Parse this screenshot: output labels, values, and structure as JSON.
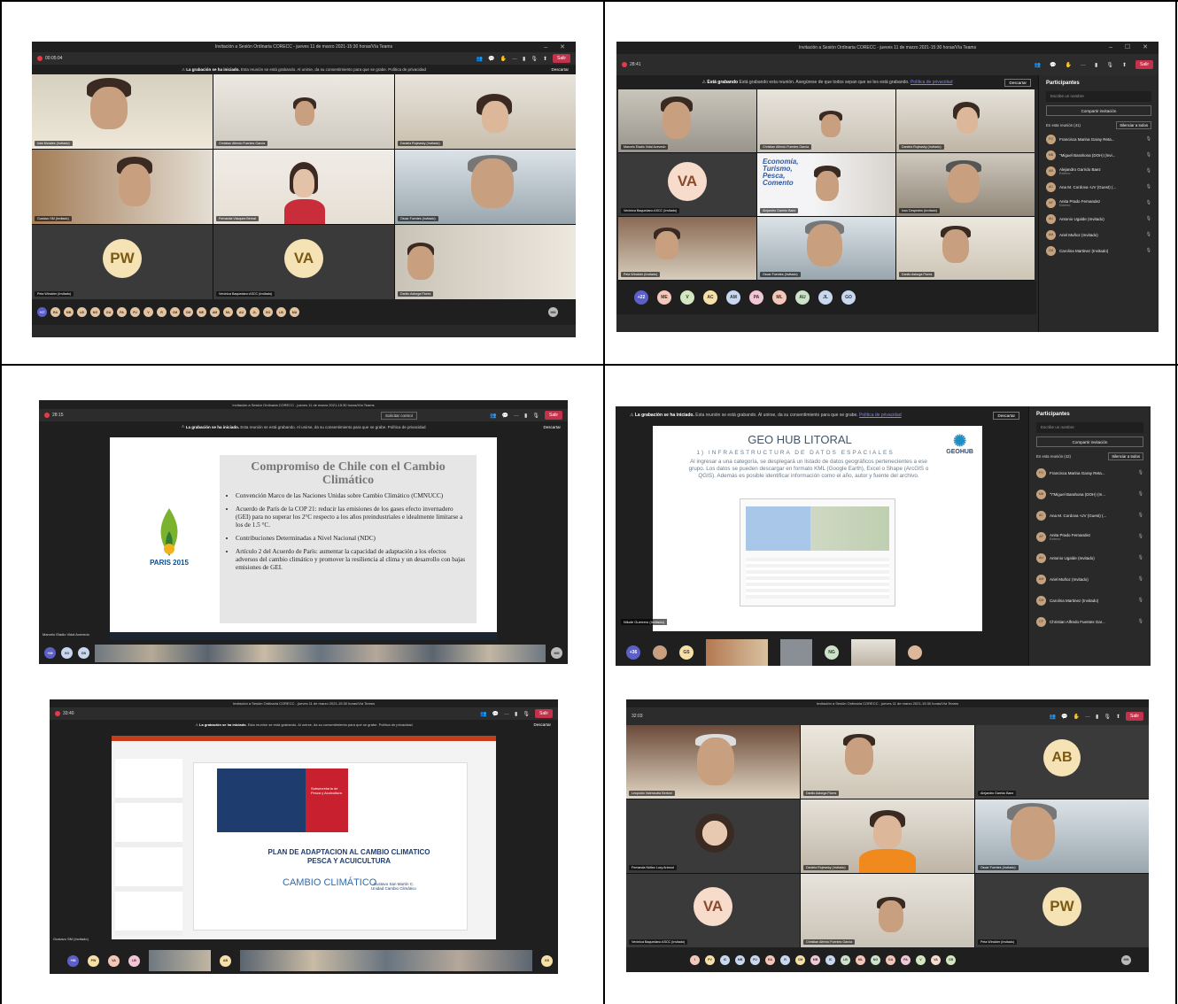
{
  "shot1": {
    "window_title": "Invitación a Sesión Ordinaria CORECC - jueves 11 de marzo 2021-15:30 horas/Vía Teams",
    "timer": "00:05:04",
    "leave_label": "Salir",
    "banner_bold": "La grabación se ha iniciado.",
    "banner_text": "Esta reunión se está grabando. Al unirse, da su consentimiento para que se grabe. Política de privacidad",
    "dismiss_label": "Descartar",
    "tiles": [
      {
        "name": "Iván Morales (Invitado)"
      },
      {
        "name": "Christian Alfredo Fuentes García"
      },
      {
        "name": "Daniela Rojewsky (Invitado)"
      },
      {
        "name": "Gustavo SM (Invitado)"
      },
      {
        "name": "Fernanda Vásquez Bernal"
      },
      {
        "name": "Oscar Fuentes (Invitado)"
      },
      {
        "name": "Peta Winckler (Invitado)",
        "avatar": "PW"
      },
      {
        "name": "Verónica Baquedano ASCC (Invitado)",
        "avatar": "VA"
      },
      {
        "name": "Danilo Astorga Flores"
      }
    ],
    "strip": [
      "+17",
      "RA",
      "MB",
      "LB",
      "NG",
      "OA",
      "PA",
      "FU",
      "V",
      "R",
      "CM",
      "CM",
      "ME",
      "AM",
      "ML",
      "AU",
      "JL",
      "GO",
      "LB",
      "MA"
    ],
    "self": "MM"
  },
  "shot2": {
    "window_title": "Invitación a Sesión Ordinaria CORECC - jueves 11 de marzo 2021-15:30 horas/Vía Teams",
    "timer": "28:41",
    "leave_label": "Salir",
    "banner_bold": "Está grabando",
    "banner_text": "Está grabando esta reunión. Asegúrese de que todos sepan que se les está grabando.",
    "policy": "Política de privacidad",
    "dismiss_label": "Descartar",
    "tiles": [
      {
        "name": "Marcelo Eladio Vidal Acevedo"
      },
      {
        "name": "Christian Alfredo Fuentes García"
      },
      {
        "name": "Daniela Rojewsky (Invitado)"
      },
      {
        "name": "Verónica Baquedano ASCC (Invitado)",
        "avatar": "VA"
      },
      {
        "name": "Alejandro Garrido Baez"
      },
      {
        "name": "Ivan Cespedes (Invitado)"
      },
      {
        "name": "Peta Winckler (Invitado)"
      },
      {
        "name": "Oscar Fuentes (Invitado)"
      },
      {
        "name": "Danilo Astorga Flores"
      }
    ],
    "strip": [
      "+22",
      "ME",
      "V",
      "AC",
      "AM",
      "PA",
      "ML",
      "AU",
      "JL",
      "GO"
    ],
    "panel": {
      "title": "Participantes",
      "search": "Escribe un nombre",
      "invite": "Compartir invitación",
      "meeting": "En esta reunión (41)",
      "mute_all": "Silenciar a todos",
      "people": [
        {
          "name": "Francisca Marina Garay Reta...",
          "initials": "FG"
        },
        {
          "name": "\"Miguel Barahona (DOH) (Invi...",
          "initials": "MB"
        },
        {
          "name": "Alejandro Garrido Baez",
          "sub": "Externo",
          "initials": "AB"
        },
        {
          "name": "Ana M. Cordova -UV (Guest) (...",
          "initials": "AC"
        },
        {
          "name": "Anita Prado Fernandez",
          "sub": "Externo",
          "initials": "AF"
        },
        {
          "name": "Antonio Ugalde (Invitado)",
          "initials": "AU"
        },
        {
          "name": "Ariel Muñoz (Invitado)",
          "initials": "AM"
        },
        {
          "name": "Carolina Martinez (Invitado)",
          "initials": "CM"
        }
      ]
    }
  },
  "shot3": {
    "window_title": "Invitación a Sesión Ordinaria CORECC - jueves 11 de marzo 2021-15:30 horas/Vía Teams",
    "timer": "28:15",
    "request_control": "Solicitar control",
    "leave_label": "Salir",
    "banner_bold": "La grabación se ha iniciado.",
    "banner_text": "Esta reunión se está grabando. Al unirse, da su consentimiento para que se grabe. Política de privacidad",
    "dismiss_label": "Descartar",
    "slide_title": "Compromiso de Chile con el Cambio Climático",
    "logo_text": "PARIS 2015",
    "bullets": [
      "Convención Marco de las Naciones Unidas sobre Cambio Climático (CMNUCC)",
      "Acuerdo de París de la COP 21: reducir las emisiones de los gases efecto invernadero (GEI) para no superar los 2°C respecto a los años preindustriales e idealmente limitarse a los de 1.5 °C.",
      "Contribuciones Determinadas a Nivel Nacional (NDC)",
      "Artículo 2 del Acuerdo de París: aumentar la capacidad de adaptación a los efectos adversos del cambio climático y promover la resiliencia al clima y un desarrollo con bajas emisiones de GEI."
    ],
    "presenter": "Marcelo Eladio Vidal Acevedo",
    "strip": [
      "+29",
      "GO",
      "DB"
    ],
    "self": "MM"
  },
  "shot4": {
    "banner_bold": "La grabación se ha iniciado.",
    "banner_text": "Esta reunión se está grabando. Al unirse, da su consentimiento para que se grabe.",
    "policy": "Política de privacidad",
    "dismiss_label": "Descartar",
    "slide_title": "GEO HUB LITORAL",
    "slide_sub": "1) INFRAESTRUCTURA DE DATOS ESPACIALES",
    "slide_logo": "GEOHUB",
    "slide_text": "Al ingresar a una categoría, se desplegará un listado de datos geográficos pertenecientes a ese grupo. Los datos se pueden descargar en formato KML (Google Earth), Excel o Shape (ArcGIS o QGIS). Además es posible identificar información como el año, autor y fuente del archivo.",
    "presenter": "Nikole Guerrero (Invitado)",
    "strip": [
      "+36",
      "GS",
      "NG"
    ],
    "panel": {
      "title": "Participantes",
      "search": "Escribe un nombre",
      "invite": "Compartir invitación",
      "meeting": "En esta reunión (42)",
      "mute_all": "Silenciar a todos",
      "people": [
        {
          "name": "Francisca Marina Garay Reta...",
          "initials": "FG"
        },
        {
          "name": "\"\\\"Miguel Barahona (DOH) (In...",
          "initials": "MB"
        },
        {
          "name": "Ana M. Cordova -UV (Guest) (...",
          "initials": "AC"
        },
        {
          "name": "Anita Prado Fernandez",
          "sub": "Externo",
          "initials": "AF"
        },
        {
          "name": "Antonio Ugalde (Invitado)",
          "initials": "AU"
        },
        {
          "name": "Ariel Muñoz (Invitado)",
          "initials": "AM"
        },
        {
          "name": "Carolina Martinez (Invitado)",
          "initials": "CM"
        },
        {
          "name": "Christian Alfredo Fuentes Gar...",
          "initials": "CF"
        }
      ]
    }
  },
  "shot5": {
    "window_title": "Invitación a Sesión Ordinaria CORECC - jueves 11 de marzo 2021-15:30 horas/Vía Teams",
    "timer": "33:40",
    "leave_label": "Salir",
    "banner_bold": "La grabación se ha iniciado.",
    "banner_text": "Esta reunión se está grabando. Al unirse, da su consentimiento para que se grabe. Política de privacidad",
    "dismiss_label": "Descartar",
    "slide_title": "PLAN DE ADAPTACION AL CAMBIO CLIMATICO\nPESCA Y ACUICULTURA",
    "slide_brand": "CAMBIO CLIMÁTICO",
    "slide_author": "Gustavo San Martín C.\nUnidad Cambio Climático",
    "slide_agency": "Subsecretaría de Pesca y Acuicultura",
    "presenter": "Gustavo SM (Invitado)",
    "strip": [
      "+36",
      "PW",
      "VA",
      "LB",
      "AB",
      "GS"
    ],
    "self": "MM"
  },
  "shot6": {
    "window_title": "Invitación a Sesión Ordinaria CORECC - jueves 11 de marzo 2021-15:30 horas/Vía Teams",
    "timer": "32:03",
    "leave_label": "Salir",
    "tiles": [
      {
        "name": "Leopoldo Valenzuela Bertoni"
      },
      {
        "name": "Danilo Astorga Flores"
      },
      {
        "name": "Alejandro Garrido Baez",
        "avatar": "AB"
      },
      {
        "name": "Fernanda Núñez Luzy Aránod"
      },
      {
        "name": "Daniela Rojewsky (Invitado)"
      },
      {
        "name": "Oscar Fuentes (Invitado)"
      },
      {
        "name": "Verónica Baquedano ASCC (Invitado)",
        "avatar": "VA"
      },
      {
        "name": "Christian Alfredo Fuentes García"
      },
      {
        "name": "Peta Winckler (Invitado)",
        "avatar": "PW"
      }
    ],
    "strip": [
      "I",
      "PV",
      "IC",
      "MB",
      "FU",
      "EA",
      "R",
      "CM",
      "MB",
      "IC",
      "LB",
      "ML",
      "NG",
      "OA",
      "PA",
      "V",
      "VA",
      "CB"
    ],
    "self": "MM"
  },
  "colors": {
    "teams_dark": "#292929",
    "leave_red": "#c4314b",
    "accent": "#5b5fc7",
    "avatar_yellow": "#f5e3b5"
  }
}
